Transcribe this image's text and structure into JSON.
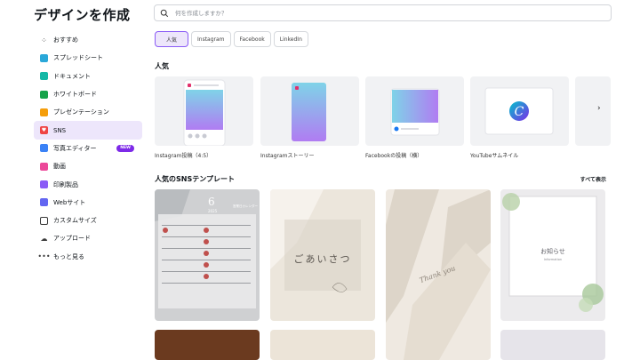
{
  "sidebar": {
    "title": "デザインを作成",
    "items": [
      {
        "label": "おすすめ",
        "icon": "sparkle-icon",
        "color": "#3a3a3a"
      },
      {
        "label": "スプレッドシート",
        "icon": "spreadsheet-icon",
        "color": "#2aa8d9"
      },
      {
        "label": "ドキュメント",
        "icon": "document-icon",
        "color": "#14b8a6"
      },
      {
        "label": "ホワイトボード",
        "icon": "whiteboard-icon",
        "color": "#16a34a"
      },
      {
        "label": "プレゼンテーション",
        "icon": "presentation-icon",
        "color": "#f59e0b"
      },
      {
        "label": "SNS",
        "icon": "heart-icon",
        "color": "#ef4444"
      },
      {
        "label": "写真エディター",
        "icon": "photo-editor-icon",
        "color": "#3b82f6",
        "badge": "NEW"
      },
      {
        "label": "動画",
        "icon": "video-icon",
        "color": "#ec4899"
      },
      {
        "label": "印刷製品",
        "icon": "print-icon",
        "color": "#8b5cf6"
      },
      {
        "label": "Webサイト",
        "icon": "website-icon",
        "color": "#6366f1"
      },
      {
        "label": "カスタムサイズ",
        "icon": "custom-size-icon",
        "color": "#3a3a3a"
      },
      {
        "label": "アップロード",
        "icon": "upload-icon",
        "color": "#3a3a3a"
      },
      {
        "label": "もっと見る",
        "icon": "more-icon",
        "color": "#3a3a3a"
      }
    ]
  },
  "search": {
    "placeholder": "何を作成しますか？"
  },
  "filters": [
    "人気",
    "Instagram",
    "Facebook",
    "LinkedIn"
  ],
  "popular": {
    "title": "人気",
    "cards": [
      "Instagram投稿（4:5）",
      "Instagramストーリー",
      "Facebookの投稿（横）",
      "YouTubeサムネイル"
    ]
  },
  "templates": {
    "title": "人気のSNSテンプレート",
    "see_all": "すべて表示",
    "items": [
      {
        "text": "6",
        "sub": "2025",
        "cap": "営業日カレンダー"
      },
      {
        "text": "ごあいさつ"
      },
      {
        "text": "Thank you"
      },
      {
        "text": "お知らせ",
        "sub": "Information"
      }
    ]
  }
}
